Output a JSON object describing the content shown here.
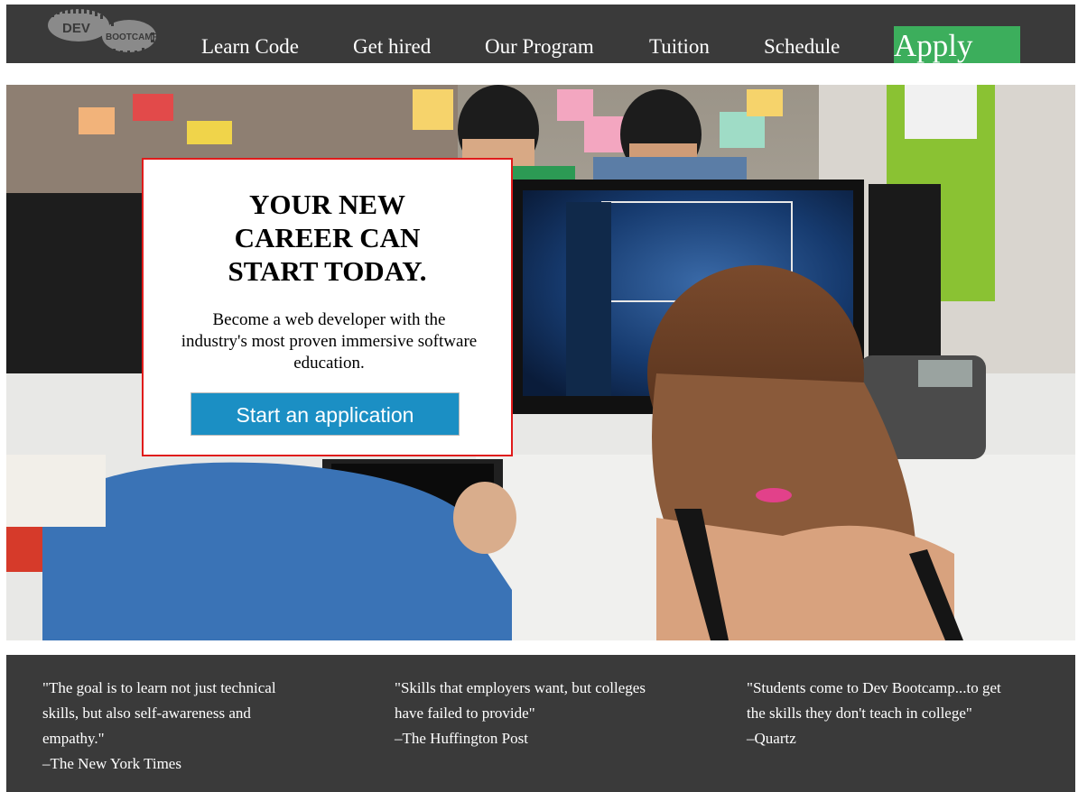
{
  "logo": {
    "text_top": "DEV",
    "text_bottom": "BOOTCAMP",
    "icon": "shoe-print-logo-icon"
  },
  "nav": {
    "items": [
      {
        "label": "Learn Code"
      },
      {
        "label": "Get hired"
      },
      {
        "label": "Our Program"
      },
      {
        "label": "Tuition"
      },
      {
        "label": "Schedule"
      }
    ],
    "apply_label": "Apply"
  },
  "hero": {
    "title_lines": [
      "YOUR NEW",
      "CAREER CAN",
      "START TODAY."
    ],
    "description": "Become a web developer with the industry's most proven immersive software education.",
    "cta_label": "Start an application",
    "photo_icon": "office-photo-icon"
  },
  "quotes": [
    {
      "text": "\"The goal is to learn not just technical skills, but also self-awareness and empathy.\"",
      "source": "–The New York Times"
    },
    {
      "text": "\"Skills that employers want, but colleges have failed to provide\"",
      "source": "–The Huffington Post"
    },
    {
      "text": "\"Students come to Dev Bootcamp...to get the skills they don't teach in college\"",
      "source": "–Quartz"
    }
  ],
  "colors": {
    "nav_bg": "#3a3a3a",
    "apply_bg": "#3cae5c",
    "cta_bg": "#1b8fc4",
    "callout_border": "#e01b1b"
  }
}
